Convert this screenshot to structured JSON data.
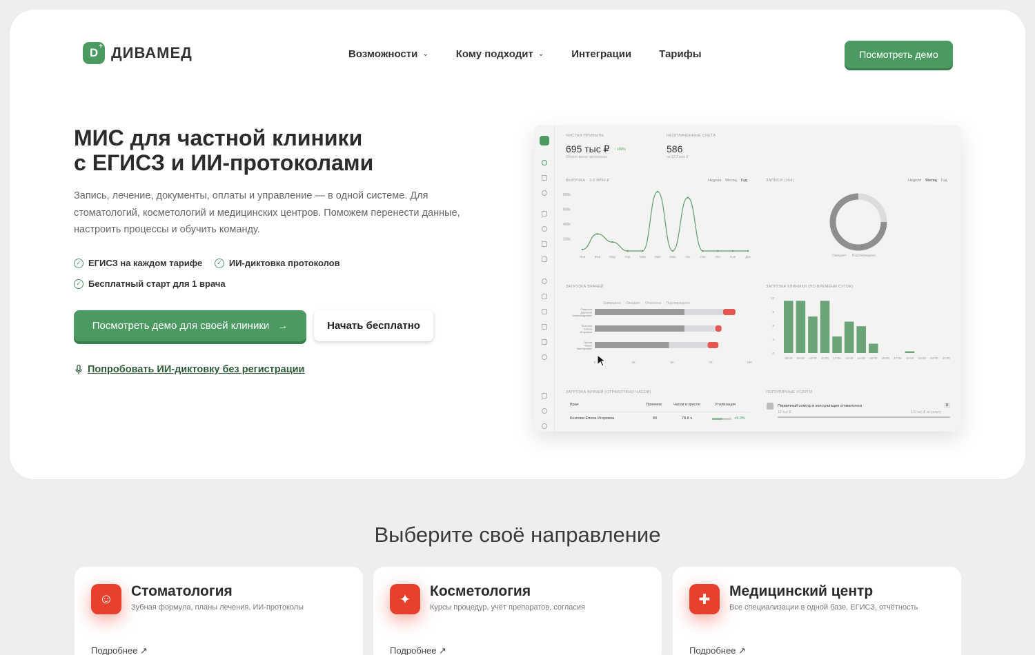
{
  "brand": {
    "name": "ДИВАМЕД",
    "mark": "D",
    "mark_plus": "+"
  },
  "nav": {
    "items": [
      {
        "label": "Возможности",
        "chev": "⌄"
      },
      {
        "label": "Кому подходит",
        "chev": "⌄"
      },
      {
        "label": "Интеграции"
      },
      {
        "label": "Тарифы"
      }
    ]
  },
  "header": {
    "demo_button": "Посмотреть демо"
  },
  "hero": {
    "title_line1": "МИС для частной клиники",
    "title_line2": "с ЕГИСЗ и ИИ-протоколами",
    "subtitle": "Запись, лечение, документы, оплаты и управление — в одной системе. Для стоматологий, косметологий и медицинских центров. Поможем перенести данные, настроить процессы и обучить команду.",
    "checks": [
      "ЕГИСЗ на каждом тарифе",
      "ИИ-диктовка протоколов",
      "Бесплатный старт для 1 врача"
    ],
    "primary_button": "Посмотреть демо для своей клиники",
    "primary_arrow": "→",
    "secondary_button": "Начать бесплатно",
    "try_link": "Попробовать ИИ-диктовку без регистрации"
  },
  "dashboard": {
    "kpi1_label": "ЧИСТАЯ ПРИБЫЛЬ",
    "kpi1_value": "695 тыс ₽",
    "kpi1_delta": "↑ 100%",
    "kpi1_note": "Оборот минус материалы",
    "kpi2_label": "НЕОПЛАЧЕННЫЕ СЧЕТА",
    "kpi2_value": "586",
    "kpi2_note": "на 13,3 млн ₽",
    "revenue_label": "ВЫРУЧКА · 3.0 МЛН ₽",
    "appointments_label": "ЗАПИСИ (364)",
    "tabs": {
      "week": "Неделя",
      "month": "Месяц",
      "year": "Год"
    },
    "donut_legend": [
      "Ожидает",
      "Подтверждено"
    ],
    "load_label": "ЗАГРУЗКА ВРАЧЕЙ",
    "load_legend": [
      "Завершено",
      "Ожидает",
      "Отменено",
      "Подтверждено"
    ],
    "clinic_load_label": "ЗАГРУЗКА КЛИНИКИ (ПО ВРЕМЕНИ СУТОК)",
    "hours_label": "ЗАГРУЗКА ВРАЧЕЙ (ОТРАБОТАНО ЧАСОВ)",
    "table_headers": [
      "Врач",
      "Приемов",
      "Часов в кресле",
      "Утилизация"
    ],
    "table_row": [
      "Козлова Елена Игоревна",
      "80",
      "78.8 ч.",
      "+9.3%"
    ],
    "popular_label": "ПОПУЛЯРНЫЕ УСЛУГИ",
    "popular_item": "Первичный осмотр и консультация стоматолога",
    "popular_count": "8",
    "popular_note_left": "12 тыс ₽",
    "popular_note_right": "1.5 тыс ₽ за услугу"
  },
  "chart_data": [
    {
      "type": "line",
      "title": "ВЫРУЧКА · 3.0 МЛН ₽",
      "categories": [
        "Янв",
        "Фев",
        "Мар",
        "Апр",
        "Май",
        "Июн",
        "Июл",
        "Авг",
        "Сен",
        "Окт",
        "Ноя",
        "Дек"
      ],
      "values": [
        20,
        230,
        120,
        0,
        0,
        800,
        0,
        720,
        0,
        0,
        0,
        0
      ],
      "ylim": [
        0,
        800
      ],
      "yticks": [
        "800k",
        "600k",
        "400k",
        "200k"
      ]
    },
    {
      "type": "pie",
      "title": "ЗАПИСИ (364)",
      "categories": [
        "Ожидает",
        "Подтверждено"
      ],
      "values": [
        25,
        75
      ],
      "colors": [
        "#dcdcdc",
        "#8f8f8f"
      ]
    },
    {
      "type": "bar",
      "title": "ЗАГРУЗКА ВРАЧЕЙ",
      "orientation": "horizontal",
      "categories": [
        "Смирнов Дмитрий Александрович",
        "Козлова Елена Игоревна",
        "Орлов Павел Викторович"
      ],
      "series": [
        {
          "name": "Завершено",
          "values": [
            58,
            58,
            48
          ]
        },
        {
          "name": "Ожидает",
          "values": [
            25,
            20,
            25
          ]
        },
        {
          "name": "Отменено",
          "values": [
            8,
            4,
            7
          ]
        }
      ],
      "xticks": [
        "0",
        "25",
        "50",
        "75",
        "100"
      ],
      "xlim": [
        0,
        100
      ]
    },
    {
      "type": "bar",
      "title": "ЗАГРУЗКА КЛИНИКИ (ПО ВРЕМЕНИ СУТОК)",
      "categories": [
        "08:00",
        "09:00",
        "10:00",
        "11:00",
        "12:00",
        "13:00",
        "14:00",
        "15:00",
        "16:00",
        "17:00",
        "18:00",
        "19:00",
        "20:00",
        "21:00"
      ],
      "values": [
        12.3,
        12.3,
        8.6,
        12.3,
        3.9,
        7.4,
        6.3,
        2.2,
        0,
        0,
        0.4,
        0,
        0,
        0
      ],
      "ylim": [
        0,
        13
      ],
      "yticks": [
        "12",
        "9",
        "6",
        "3",
        "0"
      ]
    }
  ],
  "directions": {
    "title": "Выберите своё направление",
    "cards": [
      {
        "title": "Стоматология",
        "desc": "Зубная формула, планы лечения, ИИ-протоколы",
        "more": "Подробнее ↗",
        "icon": "☺"
      },
      {
        "title": "Косметология",
        "desc": "Курсы процедур, учёт препаратов, согласия",
        "more": "Подробнее ↗",
        "icon": "✦"
      },
      {
        "title": "Медицинский центр",
        "desc": "Все специализации в одной базе, ЕГИСЗ, отчётность",
        "more": "Подробнее ↗",
        "icon": "✚"
      }
    ]
  }
}
